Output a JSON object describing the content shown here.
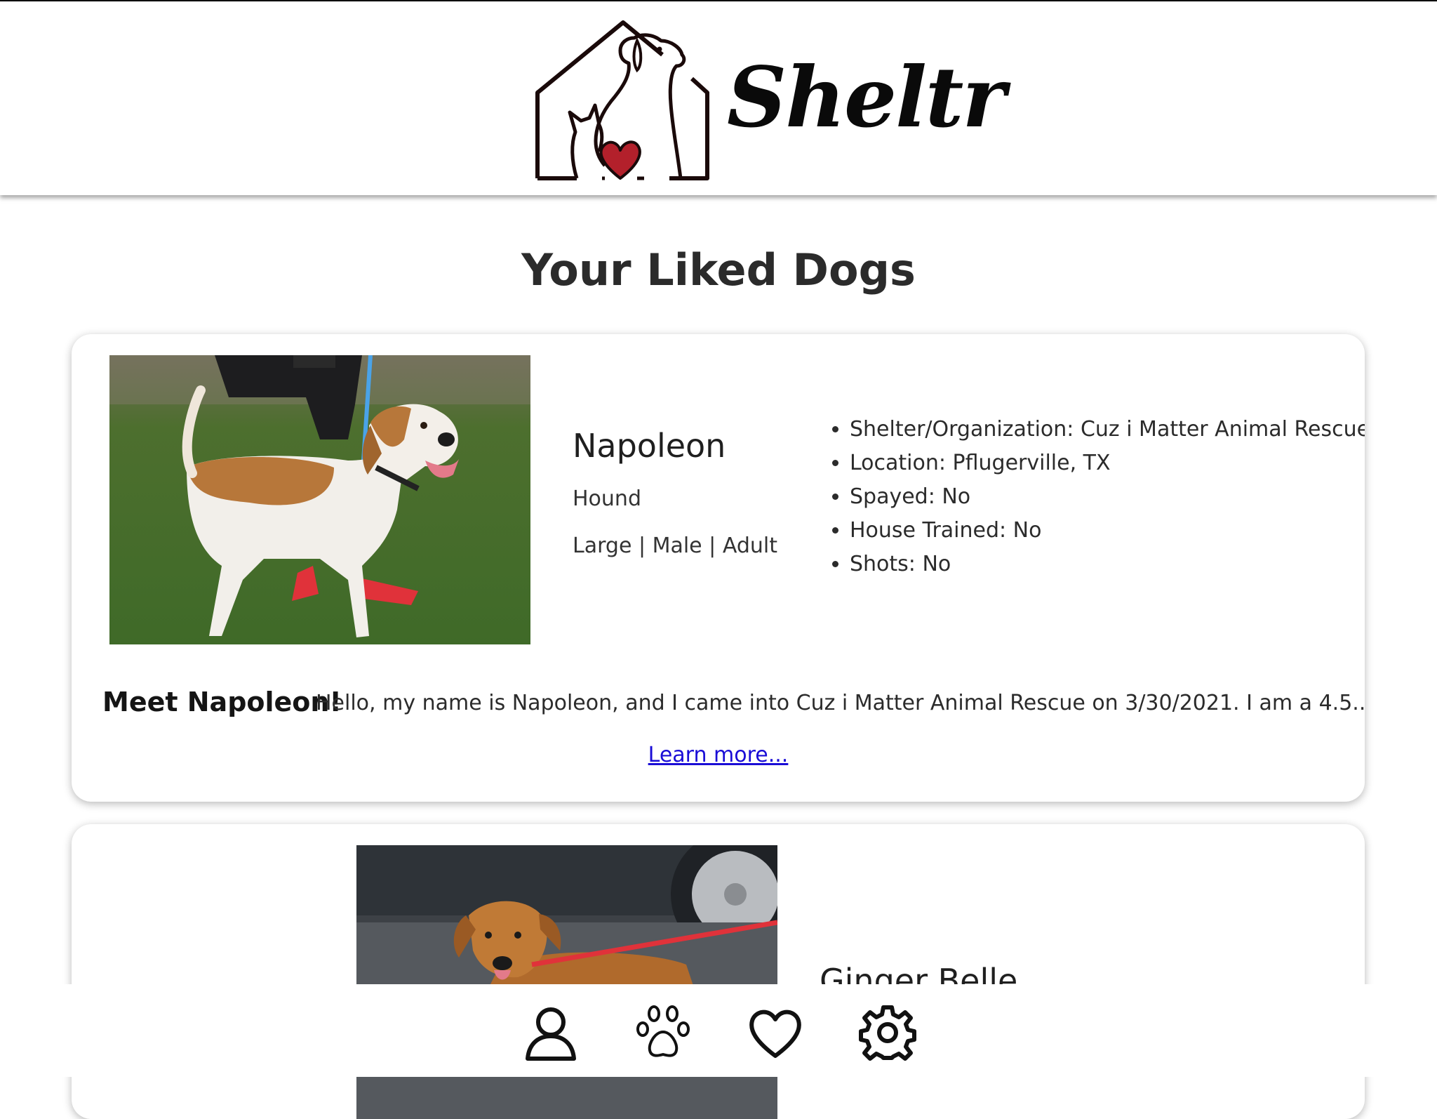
{
  "header": {
    "logo_text": "Sheltr"
  },
  "page": {
    "title": "Your Liked Dogs"
  },
  "dogs": [
    {
      "name": "Napoleon",
      "breed": "Hound",
      "traits": "Large | Male | Adult",
      "facts": [
        "Shelter/Organization: Cuz i Matter Animal Rescue",
        "Location: Pflugerville, TX",
        "Spayed: No",
        "House Trained: No",
        "Shots: No"
      ],
      "meet_label": "Meet Napoleon!",
      "description": "Hello, my name is Napoleon, and I came into Cuz i Matter Animal Rescue on 3/30/2021. I am a 4.5...",
      "learn_more": "Learn more..."
    },
    {
      "name": "Ginger Belle"
    }
  ],
  "bottom_nav": {
    "items": [
      "profile-icon",
      "paw-icon",
      "heart-icon",
      "gear-icon"
    ]
  },
  "colors": {
    "heart_red": "#b3202b",
    "link_blue": "#1a0dd6"
  }
}
